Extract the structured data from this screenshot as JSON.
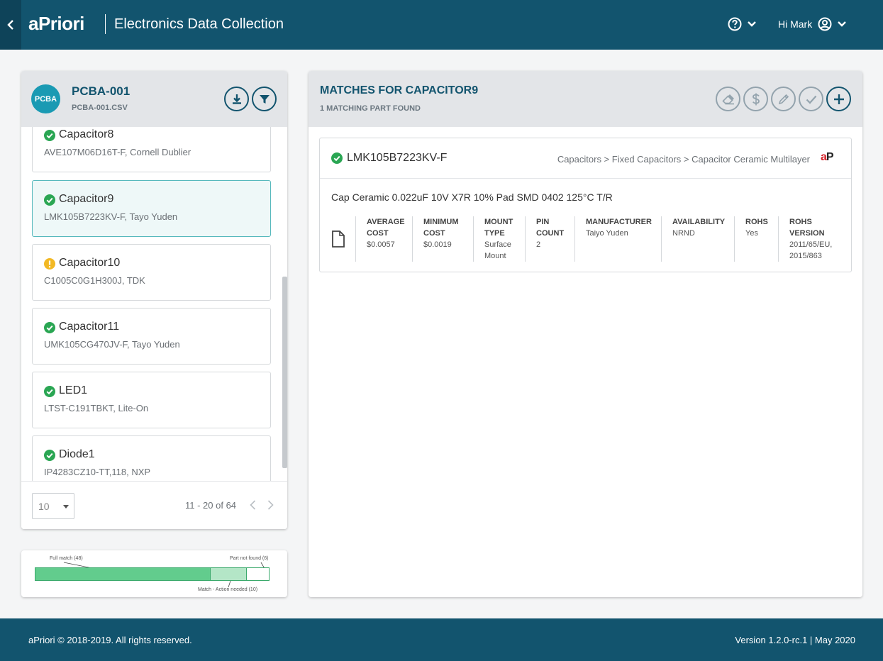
{
  "header": {
    "logo": "aPriori",
    "app_title": "Electronics Data Collection",
    "greeting": "Hi Mark"
  },
  "left_panel": {
    "avatar": "PCBA",
    "title": "PCBA-001",
    "subtitle": "PCBA-001.CSV",
    "parts": [
      {
        "name": "Capacitor8",
        "desc": "AVE107M06D16T-F, Cornell Dublier",
        "status": "matched"
      },
      {
        "name": "Capacitor9",
        "desc": "LMK105B7223KV-F, Tayo Yuden",
        "status": "matched"
      },
      {
        "name": "Capacitor10",
        "desc": "C1005C0G1H300J, TDK",
        "status": "warning"
      },
      {
        "name": "Capacitor11",
        "desc": "UMK105CG470JV-F, Tayo Yuden",
        "status": "matched"
      },
      {
        "name": "LED1",
        "desc": "LTST-C191TBKT, Lite-On",
        "status": "matched"
      },
      {
        "name": "Diode1",
        "desc": "IP4283CZ10-TT,118, NXP",
        "status": "matched"
      }
    ],
    "page_size": "10",
    "page_range": "11 - 20 of 64"
  },
  "summary": {
    "full_match": "Full match (48)",
    "not_found": "Part not found (6)",
    "action_needed": "Match - Action needed (10)",
    "full_match_fraction": 0.75,
    "action_fraction": 0.156,
    "notfound_fraction": 0.094
  },
  "right_panel": {
    "title": "MATCHES FOR CAPACITOR9",
    "subtitle": "1 MATCHING PART FOUND",
    "match": {
      "part_number": "LMK105B7223KV-F",
      "category": "Capacitors > Fixed Capacitors > Capacitor Ceramic Multilayer",
      "description": "Cap Ceramic 0.022uF 10V X7R 10% Pad SMD 0402 125°C T/R",
      "attributes": [
        {
          "label": "AVERAGE COST",
          "value": "$0.0057"
        },
        {
          "label": "MINIMUM COST",
          "value": "$0.0019"
        },
        {
          "label": "MOUNT TYPE",
          "value": "Surface Mount"
        },
        {
          "label": "PIN COUNT",
          "value": "2"
        },
        {
          "label": "MANUFACTURER",
          "value": "Taiyo Yuden"
        },
        {
          "label": "AVAILABILITY",
          "value": "NRND"
        },
        {
          "label": "ROHS",
          "value": "Yes"
        },
        {
          "label": "ROHS VERSION",
          "value": "2011/65/EU, 2015/863"
        }
      ]
    }
  },
  "footer": {
    "copyright": "aPriori © 2018-2019. All rights reserved.",
    "version": "Version 1.2.0-rc.1 | May 2020"
  },
  "colors": {
    "brand": "#12546e",
    "success": "#2aa653",
    "warning": "#f2b824"
  }
}
